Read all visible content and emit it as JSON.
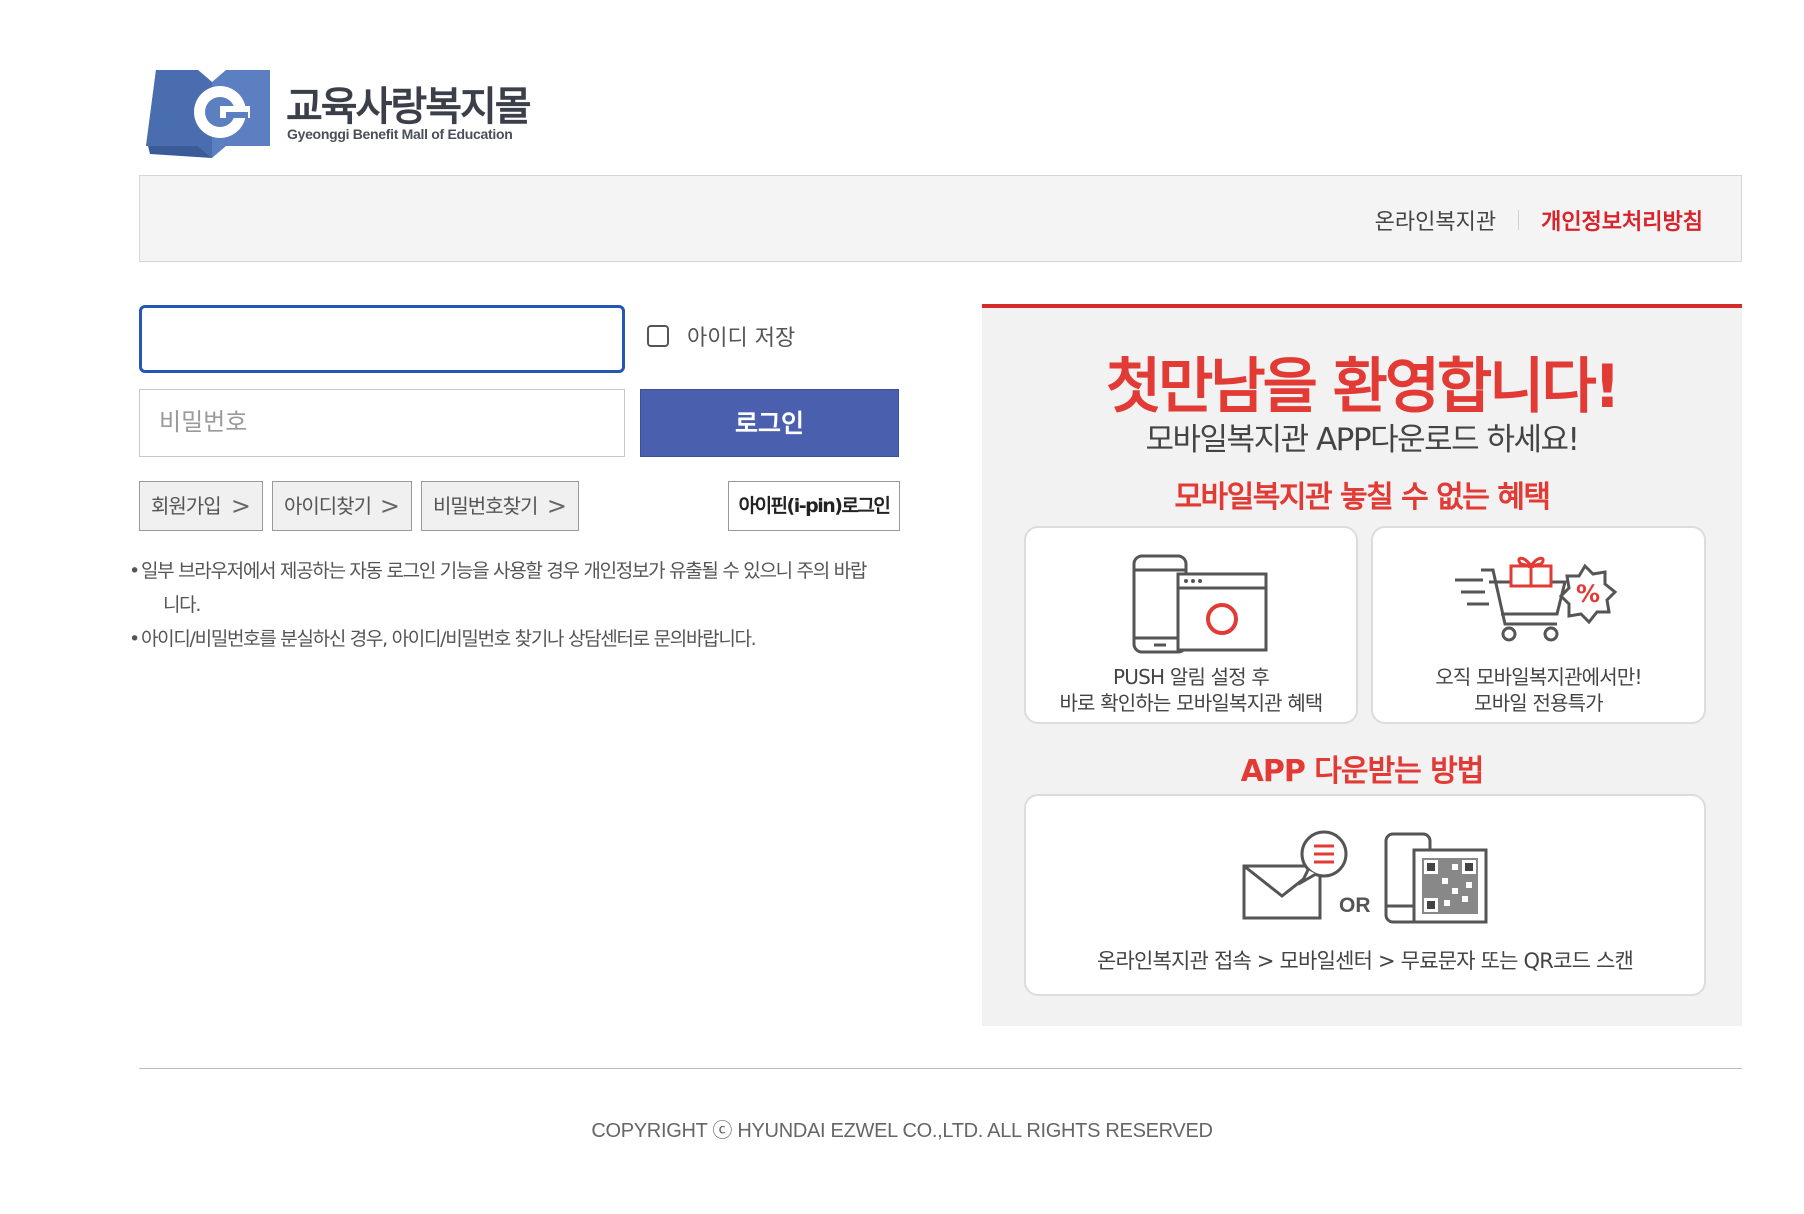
{
  "logo": {
    "title": "교육사랑복지몰",
    "subtitle": "Gyeonggi Benefit Mall of Education",
    "mark_letter": "G"
  },
  "topbar": {
    "link_online": "온라인복지관",
    "link_privacy": "개인정보처리방침"
  },
  "login": {
    "id_value": "",
    "password_placeholder": "비밀번호",
    "save_id_label": "아이디 저장",
    "save_id_checked": false,
    "login_button": "로그인",
    "signup_button": "회원가입",
    "find_id_button": "아이디찾기",
    "find_pw_button": "비밀번호찾기",
    "ipin_button": "아이핀(i-pin)로그인",
    "chevron": ">"
  },
  "notes": {
    "note1_line1": "일부 브라우저에서 제공하는 자동 로그인 기능을 사용할 경우 개인정보가 유출될 수 있으니 주의 바랍",
    "note1_line2": "니다.",
    "note2": "아이디/비밀번호를 분실하신 경우, 아이디/비밀번호 찾기나 상담센터로 문의바랍니다."
  },
  "promo": {
    "headline": "첫만남을 환영합니다!",
    "subline": "모바일복지관 APP다운로드 하세요!",
    "benefit_title": "모바일복지관 놓칠 수 없는 혜택",
    "card1_line1": "PUSH 알림 설정 후",
    "card1_line2": "바로 확인하는 모바일복지관 혜택",
    "card2_line1": "오직 모바일복지관에서만!",
    "card2_line2": "모바일 전용특가",
    "how_title": "APP 다운받는 방법",
    "or": "OR",
    "how_text": "온라인복지관 접속 > 모바일센터 > 무료문자 또는 QR코드 스캔",
    "percent": "%",
    "accent_color": "#e23a35"
  },
  "footer": {
    "copyright": "COPYRIGHT ⓒ HYUNDAI EZWEL CO.,LTD. ALL RIGHTS RESERVED"
  }
}
